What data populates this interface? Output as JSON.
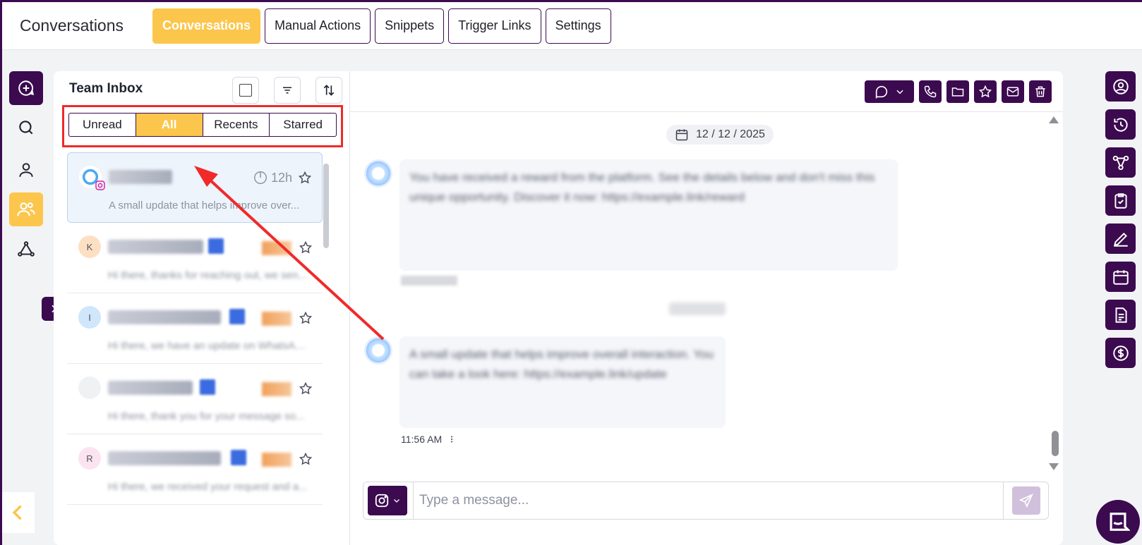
{
  "app": {
    "title": "Conversations"
  },
  "tabs": [
    {
      "label": "Conversations",
      "active": true
    },
    {
      "label": "Manual Actions",
      "active": false
    },
    {
      "label": "Snippets",
      "active": false
    },
    {
      "label": "Trigger Links",
      "active": false
    },
    {
      "label": "Settings",
      "active": false
    }
  ],
  "left_rail": {
    "icons": [
      "new-message-icon",
      "search-icon",
      "user-icon",
      "team-users-icon",
      "network-icon"
    ],
    "expand_icon": "chevron-right-icon",
    "back_icon": "chevron-left-icon"
  },
  "inbox": {
    "title": "Team Inbox",
    "filters": [
      {
        "label": "Unread",
        "active": false
      },
      {
        "label": "All",
        "active": true
      },
      {
        "label": "Recents",
        "active": false
      },
      {
        "label": "Starred",
        "active": false
      }
    ],
    "conversations": [
      {
        "initial": "",
        "time": "12h",
        "preview": "A small update that helps improve over...",
        "selected": true,
        "channel": "instagram"
      },
      {
        "initial": "K",
        "time": "",
        "preview": "Hi there, thanks for reaching out, we sen...",
        "selected": false
      },
      {
        "initial": "I",
        "time": "",
        "preview": "Hi there, we have an update on WhatsApp...",
        "selected": false
      },
      {
        "initial": "",
        "time": "",
        "preview": "Hi there, thank you for your message so...",
        "selected": false
      },
      {
        "initial": "R",
        "time": "",
        "preview": "Hi there, we received your request and a...",
        "selected": false
      }
    ]
  },
  "chat": {
    "date": "12 / 12 / 2025",
    "messages": [
      {
        "text": "You have received a reward from the platform. See the details below and don't miss this unique opportunity. Discover it now: https://example.link/reward"
      },
      {
        "text": "A small update that helps improve overall interaction. You can take a look here: https://example.link/update",
        "time": "11:56 AM"
      }
    ],
    "composer_placeholder": "Type a message..."
  },
  "colors": {
    "brand": "#3b0a4f",
    "accent": "#fcc64d",
    "highlight": "#f02a2a"
  }
}
